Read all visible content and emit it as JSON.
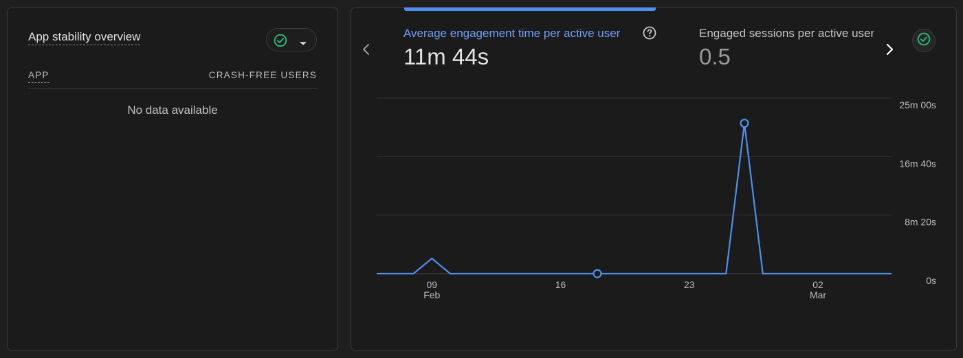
{
  "left_card": {
    "title": "App stability overview",
    "table": {
      "col_app": "APP",
      "col_crash": "CRASH-FREE USERS",
      "empty_message": "No data available"
    },
    "status_icon": "check-circle-icon",
    "dropdown_icon": "caret-down-icon"
  },
  "right_card": {
    "metrics": [
      {
        "title": "Average engagement time per active user",
        "value": "11m 44s"
      },
      {
        "title": "Engaged sessions per active user",
        "value": "0.5"
      }
    ],
    "nav": {
      "prev_icon": "chevron-left-icon",
      "next_icon": "chevron-right-icon"
    },
    "help_icon": "help-circle-icon",
    "status_icon": "check-circle-icon"
  },
  "colors": {
    "accent": "#4f8ff0",
    "status_green": "#2bb673",
    "background": "#1b1b1b"
  },
  "chart_data": {
    "type": "line",
    "y_ticks": [
      {
        "label": "25m 00s",
        "value": 1500
      },
      {
        "label": "16m 40s",
        "value": 1000
      },
      {
        "label": "8m 20s",
        "value": 500
      },
      {
        "label": "0s",
        "value": 0
      }
    ],
    "ylim": [
      0,
      1500
    ],
    "x_ticks": [
      {
        "day": 3,
        "label": "09",
        "sublabel": "Feb"
      },
      {
        "day": 10,
        "label": "16",
        "sublabel": ""
      },
      {
        "day": 17,
        "label": "23",
        "sublabel": ""
      },
      {
        "day": 24,
        "label": "02",
        "sublabel": "Mar"
      }
    ],
    "xlim": [
      0,
      28
    ],
    "series": [
      {
        "color": "#4f8ff0",
        "points": [
          [
            0,
            0
          ],
          [
            1,
            0
          ],
          [
            2,
            0
          ],
          [
            3,
            130
          ],
          [
            4,
            0
          ],
          [
            5,
            0
          ],
          [
            6,
            0
          ],
          [
            7,
            0
          ],
          [
            8,
            0
          ],
          [
            9,
            0
          ],
          [
            10,
            0
          ],
          [
            11,
            0
          ],
          [
            12,
            0
          ],
          [
            13,
            0
          ],
          [
            14,
            0
          ],
          [
            15,
            0
          ],
          [
            16,
            0
          ],
          [
            17,
            0
          ],
          [
            18,
            0
          ],
          [
            19,
            0
          ],
          [
            20,
            1285
          ],
          [
            21,
            0
          ],
          [
            22,
            0
          ],
          [
            23,
            0
          ],
          [
            24,
            0
          ],
          [
            25,
            0
          ],
          [
            26,
            0
          ],
          [
            27,
            0
          ],
          [
            28,
            0
          ]
        ],
        "markers": [
          12,
          20
        ]
      }
    ],
    "grid": true
  }
}
